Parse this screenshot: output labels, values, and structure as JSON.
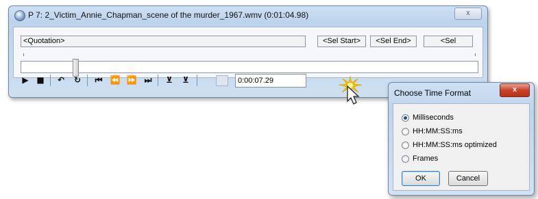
{
  "player": {
    "title": "P 7: 2_Victim_Annie_Chapman_scene of the murder_1967.wmv (0:01:04.98)",
    "close_label": "x",
    "quotation_value": "<Quotation>",
    "sel_start_label": "<Sel Start>",
    "sel_end_label": "<Sel End>",
    "sel_third_label": "<Sel",
    "timeline_position": 0.12,
    "time_value": "0:00:07.29",
    "toolbar": [
      {
        "icon": "play-icon",
        "glyph": "▶"
      },
      {
        "icon": "stop-icon",
        "glyph": "■"
      },
      {
        "icon": "loop-icon",
        "glyph": "↶"
      },
      {
        "icon": "reload-icon",
        "glyph": "↻"
      },
      {
        "icon": "skip-back-icon",
        "glyph": "⏮"
      },
      {
        "icon": "rewind-icon",
        "glyph": "⏪"
      },
      {
        "icon": "fast-forward-icon",
        "glyph": "⏩"
      },
      {
        "icon": "skip-forward-icon",
        "glyph": "⏭"
      },
      {
        "icon": "set-start-icon",
        "glyph": "⊻"
      },
      {
        "icon": "set-end-icon",
        "glyph": "⊻"
      }
    ]
  },
  "dialog": {
    "title": "Choose Time Format",
    "close_label": "x",
    "options": [
      {
        "label": "Milliseconds",
        "checked": true
      },
      {
        "label": "HH:MM:SS:ms",
        "checked": false
      },
      {
        "label": "HH:MM:SS:ms optimized",
        "checked": false
      },
      {
        "label": "Frames",
        "checked": false
      }
    ],
    "ok_label": "OK",
    "cancel_label": "Cancel"
  },
  "colors": {
    "window_frame": "#cfe0f3",
    "close_red": "#c8422a",
    "burst_yellow": "#f2c200"
  }
}
